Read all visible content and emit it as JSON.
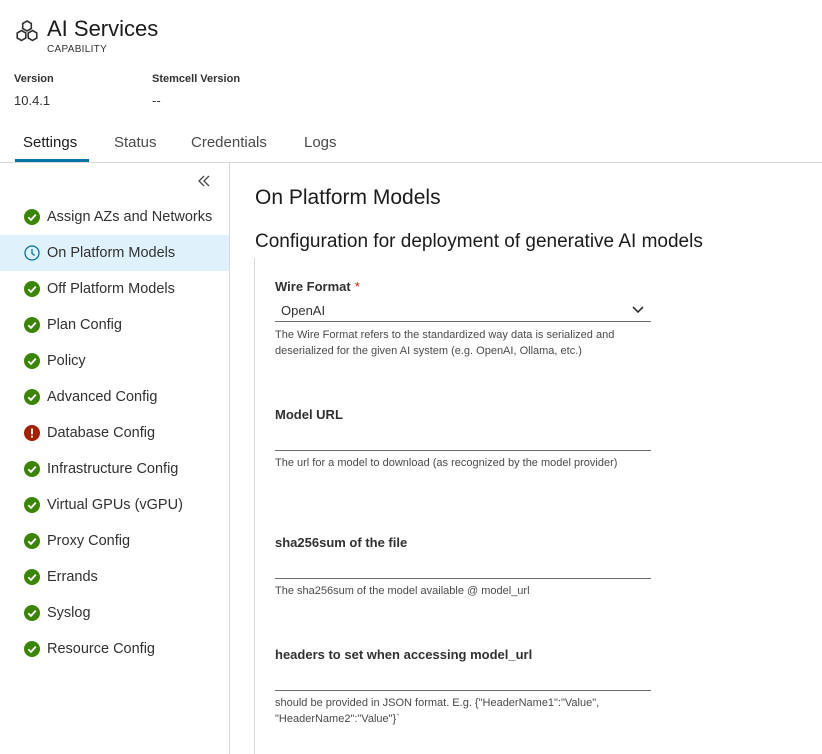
{
  "header": {
    "icon": "hexagon-cluster-icon",
    "title": "AI Services",
    "subtitle": "CAPABILITY",
    "version_label": "Version",
    "version_value": "10.4.1",
    "stemcell_label": "Stemcell Version",
    "stemcell_value": "--"
  },
  "tabs": [
    {
      "label": "Settings",
      "active": true
    },
    {
      "label": "Status",
      "active": false
    },
    {
      "label": "Credentials",
      "active": false
    },
    {
      "label": "Logs",
      "active": false
    }
  ],
  "sidebar": {
    "collapse_icon": "double-chevron-left-icon",
    "items": [
      {
        "label": "Assign AZs and Networks",
        "status": "complete"
      },
      {
        "label": "On Platform Models",
        "status": "in-progress"
      },
      {
        "label": "Off Platform Models",
        "status": "complete"
      },
      {
        "label": "Plan Config",
        "status": "complete"
      },
      {
        "label": "Policy",
        "status": "complete"
      },
      {
        "label": "Advanced Config",
        "status": "complete"
      },
      {
        "label": "Database Config",
        "status": "error"
      },
      {
        "label": "Infrastructure Config",
        "status": "complete"
      },
      {
        "label": "Virtual GPUs (vGPU)",
        "status": "complete"
      },
      {
        "label": "Proxy Config",
        "status": "complete"
      },
      {
        "label": "Errands",
        "status": "complete"
      },
      {
        "label": "Syslog",
        "status": "complete"
      },
      {
        "label": "Resource Config",
        "status": "complete"
      }
    ]
  },
  "main": {
    "title": "On Platform Models",
    "section_title": "Configuration for deployment of generative AI models",
    "fields": {
      "wire_format": {
        "label": "Wire Format",
        "required_mark": "*",
        "value": "OpenAI",
        "help": "The Wire Format refers to the standardized way data is serialized and deserialized for the given AI system (e.g. OpenAI, Ollama, etc.)"
      },
      "model_url": {
        "label": "Model URL",
        "value": "",
        "help": "The url for a model to download (as recognized by the model provider)"
      },
      "sha256sum": {
        "label": "sha256sum of the file",
        "value": "",
        "help": "The sha256sum of the model available @ model_url"
      },
      "headers": {
        "label": "headers to set when accessing model_url",
        "value": "",
        "help": "should be provided in JSON format. E.g. {\"HeaderName1\":\"Value\", \"HeaderName2\":\"Value\"}`"
      }
    }
  },
  "colors": {
    "complete": "#3c8500",
    "error": "#a32100",
    "in_progress": "#0072a3",
    "active_bg": "#dff2fb",
    "tab_accent": "#0072a3",
    "required": "#c21d00"
  }
}
